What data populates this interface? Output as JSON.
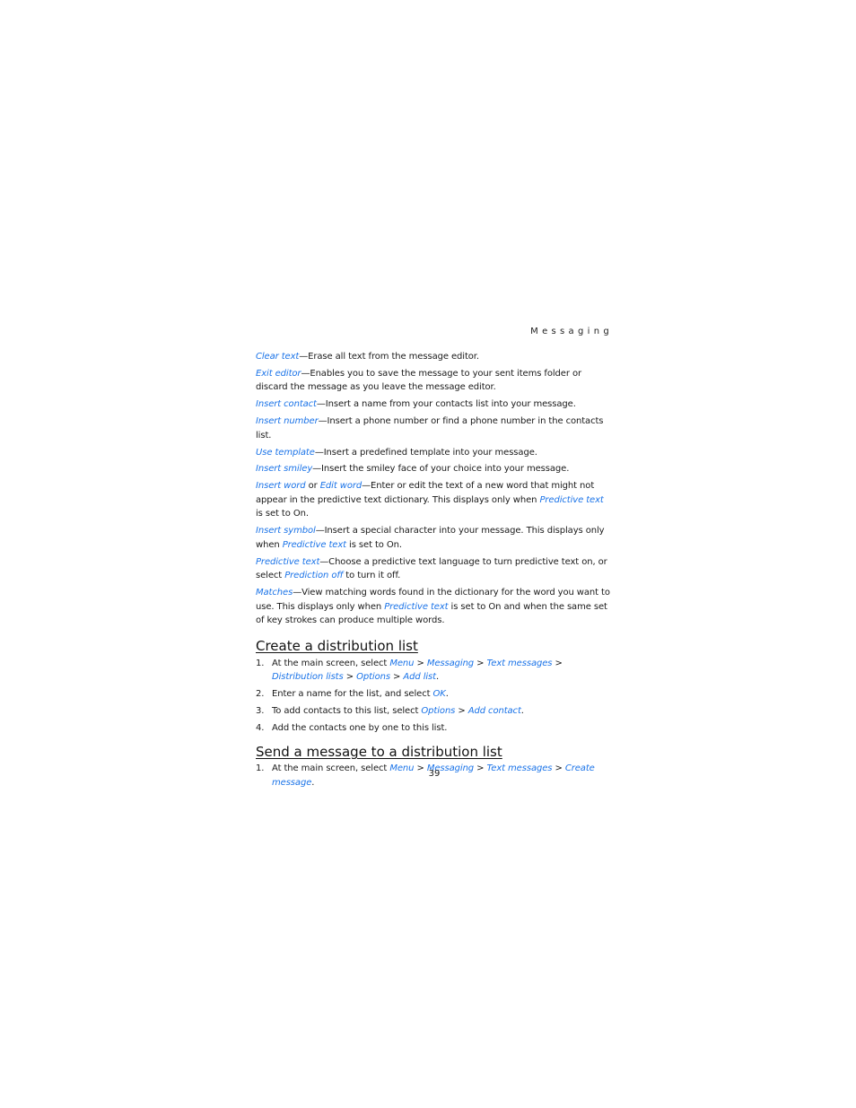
{
  "header": {
    "section": "Messaging"
  },
  "options": [
    {
      "parts": [
        {
          "t": "Clear text",
          "link": true
        },
        {
          "t": "—Erase all text from the message editor.",
          "link": false
        }
      ]
    },
    {
      "parts": [
        {
          "t": "Exit editor",
          "link": true
        },
        {
          "t": "—Enables you to save the message to your sent items folder or discard the message as you leave the message editor.",
          "link": false
        }
      ]
    },
    {
      "parts": [
        {
          "t": "Insert contact",
          "link": true
        },
        {
          "t": "—Insert a name from your contacts list into your message.",
          "link": false
        }
      ]
    },
    {
      "parts": [
        {
          "t": "Insert number",
          "link": true
        },
        {
          "t": "—Insert a phone number or find a phone number in the contacts list.",
          "link": false
        }
      ]
    },
    {
      "parts": [
        {
          "t": "Use template",
          "link": true
        },
        {
          "t": "—Insert a predefined template into your message.",
          "link": false
        }
      ]
    },
    {
      "parts": [
        {
          "t": "Insert smiley",
          "link": true
        },
        {
          "t": "—Insert the smiley face of your choice into your message.",
          "link": false
        }
      ]
    },
    {
      "parts": [
        {
          "t": "Insert word",
          "link": true
        },
        {
          "t": " or ",
          "link": false
        },
        {
          "t": "Edit word",
          "link": true
        },
        {
          "t": "—Enter or edit the text of a new word that might not appear in the predictive text dictionary. This displays only when ",
          "link": false
        },
        {
          "t": "Predictive text",
          "link": true
        },
        {
          "t": " is set to On.",
          "link": false
        }
      ]
    },
    {
      "parts": [
        {
          "t": "Insert symbol",
          "link": true
        },
        {
          "t": "—Insert a special character into your message. This displays only when ",
          "link": false
        },
        {
          "t": "Predictive text",
          "link": true
        },
        {
          "t": " is set to On.",
          "link": false
        }
      ]
    },
    {
      "parts": [
        {
          "t": "Predictive text",
          "link": true
        },
        {
          "t": "—Choose a predictive text language to turn predictive text on, or select ",
          "link": false
        },
        {
          "t": "Prediction off",
          "link": true
        },
        {
          "t": " to turn it off.",
          "link": false
        }
      ]
    },
    {
      "parts": [
        {
          "t": "Matches",
          "link": true
        },
        {
          "t": "—View matching words found in the dictionary for the word you want to use. This displays only when ",
          "link": false
        },
        {
          "t": "Predictive text",
          "link": true
        },
        {
          "t": " is set to On and when the same set of key strokes can produce multiple words.",
          "link": false
        }
      ]
    }
  ],
  "sections": {
    "create": {
      "heading": "Create a distribution list",
      "steps": [
        {
          "num": "1.",
          "parts": [
            {
              "t": "At the main screen, select ",
              "link": false
            },
            {
              "t": "Menu",
              "link": true
            },
            {
              "t": " > ",
              "link": false
            },
            {
              "t": "Messaging",
              "link": true
            },
            {
              "t": " > ",
              "link": false
            },
            {
              "t": "Text messages",
              "link": true
            },
            {
              "t": " > ",
              "link": false
            },
            {
              "t": "Distribution lists",
              "link": true
            },
            {
              "t": " > ",
              "link": false
            },
            {
              "t": "Options",
              "link": true
            },
            {
              "t": " > ",
              "link": false
            },
            {
              "t": "Add list",
              "link": true
            },
            {
              "t": ".",
              "link": false
            }
          ]
        },
        {
          "num": "2.",
          "parts": [
            {
              "t": "Enter a name for the list, and select ",
              "link": false
            },
            {
              "t": "OK",
              "link": true
            },
            {
              "t": ".",
              "link": false
            }
          ]
        },
        {
          "num": "3.",
          "parts": [
            {
              "t": "To add contacts to this list, select ",
              "link": false
            },
            {
              "t": "Options",
              "link": true
            },
            {
              "t": " > ",
              "link": false
            },
            {
              "t": "Add contact",
              "link": true
            },
            {
              "t": ".",
              "link": false
            }
          ]
        },
        {
          "num": "4.",
          "parts": [
            {
              "t": "Add the contacts one by one to this list.",
              "link": false
            }
          ]
        }
      ]
    },
    "send": {
      "heading": "Send a message to a distribution list",
      "steps": [
        {
          "num": "1.",
          "parts": [
            {
              "t": "At the main screen, select ",
              "link": false
            },
            {
              "t": "Menu",
              "link": true
            },
            {
              "t": " > ",
              "link": false
            },
            {
              "t": "Messaging",
              "link": true
            },
            {
              "t": " > ",
              "link": false
            },
            {
              "t": "Text messages",
              "link": true
            },
            {
              "t": " > ",
              "link": false
            },
            {
              "t": "Create message",
              "link": true
            },
            {
              "t": ".",
              "link": false
            }
          ]
        }
      ]
    }
  },
  "footer": {
    "page_number": "39"
  },
  "colors": {
    "link": "#1a73e8",
    "text": "#1a1a1a"
  }
}
